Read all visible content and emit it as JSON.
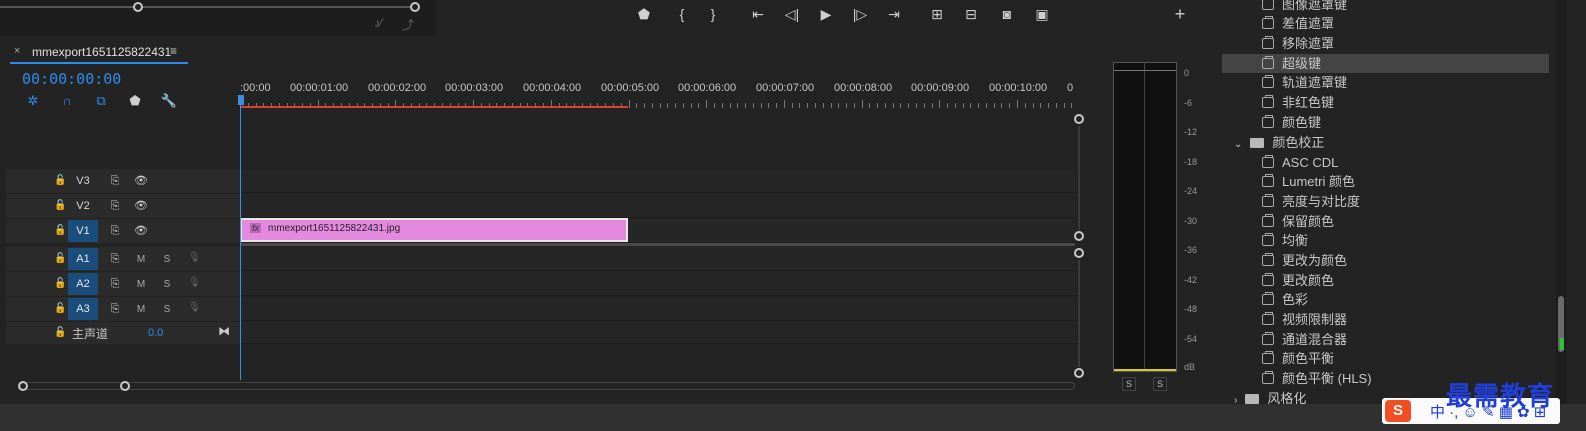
{
  "timeline": {
    "sequence_name": "mmexport1651125822431",
    "close_symbol": "×",
    "menu_symbol": "≡",
    "timecode": "00:00:00:00",
    "ruler": [
      ":00:00",
      "00:00:01:00",
      "00:00:02:00",
      "00:00:03:00",
      "00:00:04:00",
      "00:00:05:00",
      "00:00:06:00",
      "00:00:07:00",
      "00:00:08:00",
      "00:00:09:00",
      "00:00:10:00",
      "0"
    ],
    "tracks": {
      "v3": "V3",
      "v2": "V2",
      "v1": "V1",
      "a1": "A1",
      "a2": "A2",
      "a3": "A3",
      "mute": "M",
      "solo": "S"
    },
    "clip": {
      "fx": "fx",
      "name": "mmexport1651125822431.jpg",
      "color": "#e38ae0"
    },
    "master": {
      "label": "主声道",
      "value": "0.0"
    }
  },
  "meter": {
    "db_labels": [
      "0",
      "-6",
      "-12",
      "-18",
      "-24",
      "-30",
      "-36",
      "-42",
      "-48",
      "-54",
      "dB"
    ],
    "solo_left": "S",
    "solo_right": "S"
  },
  "effects": {
    "items_top": [
      "图像遮罩键",
      "差值遮罩",
      "移除遮罩",
      "超级键",
      "轨道遮罩键",
      "非红色键",
      "颜色键"
    ],
    "selected_item": "超级键",
    "folder_color_correction": "颜色校正",
    "items_color": [
      "ASC CDL",
      "Lumetri 颜色",
      "亮度与对比度",
      "保留颜色",
      "均衡",
      "更改为颜色",
      "更改颜色",
      "色彩",
      "视频限制器",
      "通道混合器",
      "颜色平衡",
      "颜色平衡 (HLS)"
    ],
    "folder_stylize": "风格化"
  },
  "overlay": {
    "watermark": "最需教育",
    "ime_logo": "S",
    "ime_text": "中 ·, ☺ ✎ ▦ ✿ ⊞"
  },
  "colors": {
    "accent": "#2d8ceb",
    "workarea": "#d8403a",
    "meter_peak": "#d7c825"
  }
}
